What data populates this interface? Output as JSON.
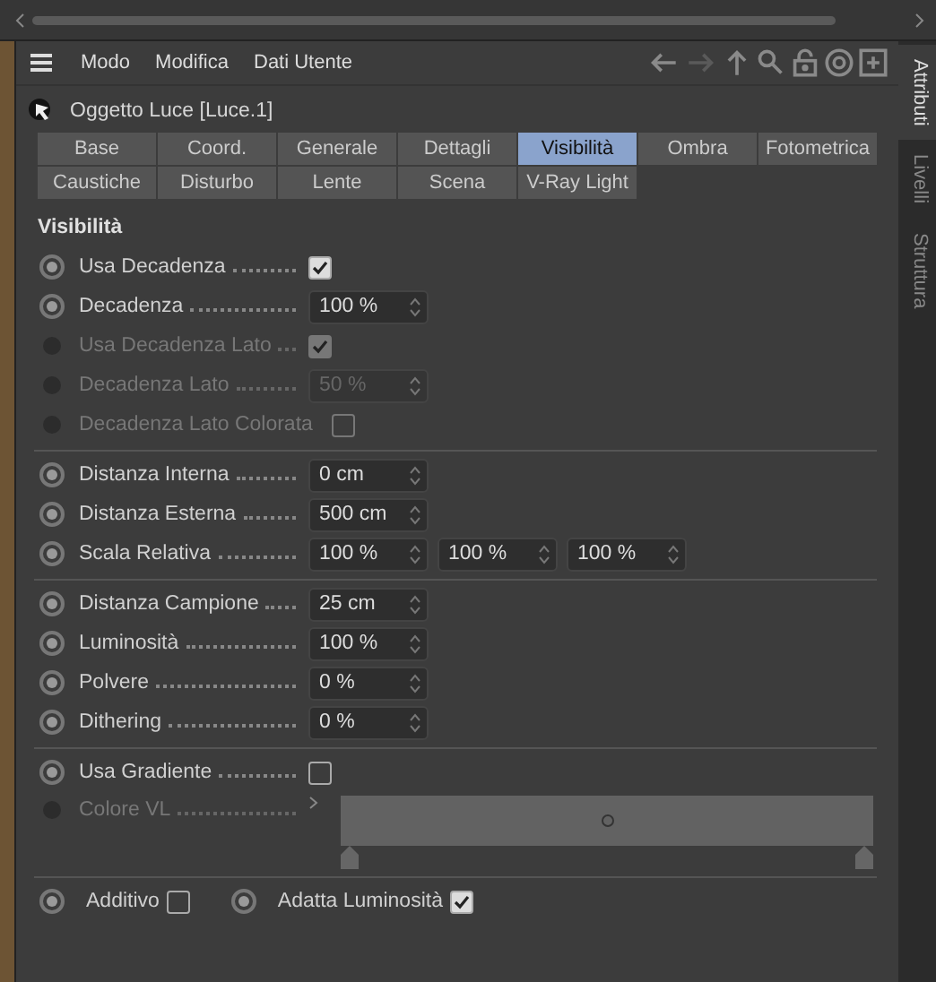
{
  "menu": [
    "Modo",
    "Modifica",
    "Dati Utente"
  ],
  "object_title": "Oggetto Luce [Luce.1]",
  "tabs": [
    {
      "label": "Base",
      "selected": false
    },
    {
      "label": "Coord.",
      "selected": false
    },
    {
      "label": "Generale",
      "selected": false
    },
    {
      "label": "Dettagli",
      "selected": false
    },
    {
      "label": "Visibilità",
      "selected": true
    },
    {
      "label": "Ombra",
      "selected": false
    },
    {
      "label": "Fotometrica",
      "selected": false
    },
    {
      "label": "Caustiche",
      "selected": false
    },
    {
      "label": "Disturbo",
      "selected": false
    },
    {
      "label": "Lente",
      "selected": false
    },
    {
      "label": "Scena",
      "selected": false
    },
    {
      "label": "V-Ray Light",
      "selected": false
    }
  ],
  "section_title": "Visibilità",
  "groups": [
    [
      {
        "kind": "checkbox",
        "label": "Usa Decadenza",
        "checked": true,
        "disabled": false
      },
      {
        "kind": "field",
        "label": "Decadenza",
        "values": [
          "100 %"
        ],
        "disabled": false
      },
      {
        "kind": "checkbox",
        "label": "Usa Decadenza Lato",
        "checked": true,
        "disabled": true
      },
      {
        "kind": "field",
        "label": "Decadenza Lato",
        "values": [
          "50 %"
        ],
        "disabled": true
      },
      {
        "kind": "checkbox",
        "label": "Decadenza Lato Colorata",
        "checked": false,
        "disabled": true
      }
    ],
    [
      {
        "kind": "field",
        "label": "Distanza Interna",
        "values": [
          "0 cm"
        ],
        "disabled": false
      },
      {
        "kind": "field",
        "label": "Distanza Esterna",
        "values": [
          "500 cm"
        ],
        "disabled": false
      },
      {
        "kind": "field",
        "label": "Scala Relativa",
        "values": [
          "100 %",
          "100 %",
          "100 %"
        ],
        "disabled": false
      }
    ],
    [
      {
        "kind": "field",
        "label": "Distanza Campione",
        "values": [
          "25 cm"
        ],
        "disabled": false
      },
      {
        "kind": "field",
        "label": "Luminosità",
        "values": [
          "100 %"
        ],
        "disabled": false
      },
      {
        "kind": "field",
        "label": "Polvere",
        "values": [
          "0 %"
        ],
        "disabled": false
      },
      {
        "kind": "field",
        "label": "Dithering",
        "values": [
          "0 %"
        ],
        "disabled": false
      }
    ],
    [
      {
        "kind": "checkbox",
        "label": "Usa Gradiente",
        "checked": false,
        "disabled": false
      },
      {
        "kind": "gradient",
        "label": "Colore VL",
        "disabled": true
      }
    ]
  ],
  "bottom_options": [
    {
      "label": "Additivo",
      "checked": false
    },
    {
      "label": "Adatta Luminosità",
      "checked": true
    }
  ],
  "side_tabs": [
    {
      "label": "Attributi",
      "selected": true
    },
    {
      "label": "Livelli",
      "selected": false
    },
    {
      "label": "Struttura",
      "selected": false
    }
  ]
}
